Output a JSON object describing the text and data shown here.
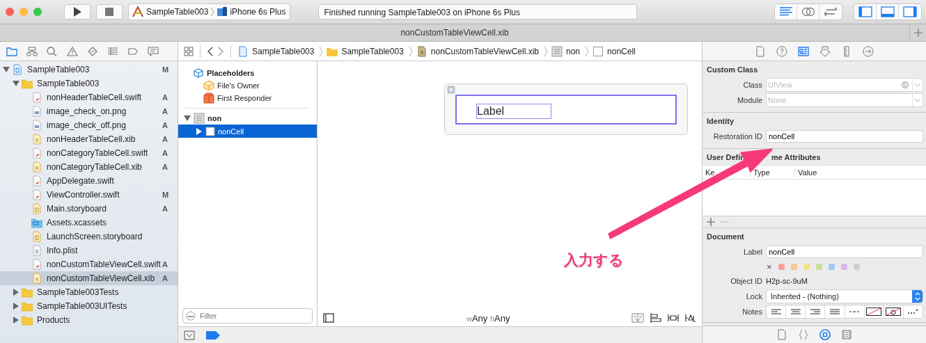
{
  "toolbar": {
    "scheme": {
      "target": "SampleTable003",
      "device": "iPhone 6s Plus"
    },
    "activity": "Finished running SampleTable003 on iPhone 6s Plus",
    "editor_modes": [
      {
        "kind": "standard",
        "selected": true
      },
      {
        "kind": "assistant",
        "selected": false
      },
      {
        "kind": "version",
        "selected": false
      }
    ],
    "panels": [
      {
        "kind": "navigator",
        "on": true
      },
      {
        "kind": "debug",
        "on": true
      },
      {
        "kind": "utilities",
        "on": true
      }
    ]
  },
  "tab": {
    "title": "nonCustomTableViewCell.xib"
  },
  "navigator": {
    "tabs": [
      {
        "kind": "folder",
        "selected": true
      },
      {
        "kind": "hierarchy",
        "selected": false
      },
      {
        "kind": "search",
        "selected": false
      },
      {
        "kind": "warning",
        "selected": false
      },
      {
        "kind": "test",
        "selected": false
      },
      {
        "kind": "debug",
        "selected": false
      },
      {
        "kind": "breakpoint",
        "selected": false
      },
      {
        "kind": "report",
        "selected": false
      }
    ],
    "tree": [
      {
        "kind": "project",
        "name": "SampleTable003",
        "status": "M",
        "expanded": true,
        "selected": false,
        "children": [
          {
            "kind": "folder",
            "name": "SampleTable003",
            "expanded": true,
            "selected": false,
            "children": [
              {
                "kind": "swift",
                "name": "nonHeaderTableCell.swift",
                "status": "A",
                "selected": false
              },
              {
                "kind": "png",
                "name": "image_check_on.png",
                "status": "A",
                "selected": false
              },
              {
                "kind": "png",
                "name": "image_check_off.png",
                "status": "A",
                "selected": false
              },
              {
                "kind": "xib",
                "name": "nonHeaderTableCell.xib",
                "status": "A",
                "selected": false
              },
              {
                "kind": "swift",
                "name": "nonCategoryTableCell.swift",
                "status": "A",
                "selected": false
              },
              {
                "kind": "xib",
                "name": "nonCategoryTableCell.xib",
                "status": "A",
                "selected": false
              },
              {
                "kind": "swift",
                "name": "AppDelegate.swift",
                "selected": false
              },
              {
                "kind": "swift",
                "name": "ViewController.swift",
                "status": "M",
                "selected": false
              },
              {
                "kind": "storyboard",
                "name": "Main.storyboard",
                "status": "A",
                "selected": false
              },
              {
                "kind": "xcassets",
                "name": "Assets.xcassets",
                "selected": false
              },
              {
                "kind": "storyboard",
                "name": "LaunchScreen.storyboard",
                "selected": false
              },
              {
                "kind": "plist",
                "name": "Info.plist",
                "selected": false
              },
              {
                "kind": "swift",
                "name": "nonCustomTableViewCell.swift",
                "status": "A",
                "selected": false
              },
              {
                "kind": "xib",
                "name": "nonCustomTableViewCell.xib",
                "status": "A",
                "selected": true
              }
            ]
          },
          {
            "kind": "folder",
            "name": "SampleTable003Tests",
            "expanded": false,
            "selected": false
          },
          {
            "kind": "folder",
            "name": "SampleTable003UITests",
            "expanded": false,
            "selected": false
          },
          {
            "kind": "folder",
            "name": "Products",
            "expanded": false,
            "selected": false
          }
        ]
      }
    ]
  },
  "jump_bar": [
    {
      "kind": "project",
      "label": "SampleTable003"
    },
    {
      "kind": "folder",
      "label": "SampleTable003"
    },
    {
      "kind": "xib",
      "label": "nonCustomTableViewCell.xib"
    },
    {
      "kind": "view",
      "label": "non"
    },
    {
      "kind": "cell",
      "label": "nonCell"
    }
  ],
  "outline": {
    "header": "Placeholders",
    "placeholders": [
      {
        "kind": "owner",
        "label": "File's Owner"
      },
      {
        "kind": "responder",
        "label": "First Responder"
      }
    ],
    "objects": [
      {
        "label": "non",
        "expanded": true,
        "selected": false,
        "children": [
          {
            "label": "nonCell",
            "expanded": false,
            "selected": true
          }
        ]
      }
    ],
    "filter": {
      "placeholder": "Filter"
    }
  },
  "canvas": {
    "label": "Label",
    "size_class": {
      "w_prefix": "w",
      "w": "Any",
      "h_prefix": "h",
      "h": "Any"
    }
  },
  "inspector": {
    "tabs": [
      {
        "kind": "file",
        "selected": false
      },
      {
        "kind": "help",
        "selected": false
      },
      {
        "kind": "identity",
        "selected": true
      },
      {
        "kind": "attributes",
        "selected": false
      },
      {
        "kind": "size",
        "selected": false
      },
      {
        "kind": "connections",
        "selected": false
      }
    ],
    "custom_class": {
      "title": "Custom Class",
      "class_label": "Class",
      "class_placeholder": "UIView",
      "module_label": "Module",
      "module_placeholder": "None"
    },
    "identity": {
      "title": "Identity",
      "restoration_label": "Restoration ID",
      "restoration_value": "nonCell"
    },
    "runtime_attributes": {
      "title_start": "User Defin",
      "title_end": "me Attributes",
      "columns": [
        "Ke",
        "Type",
        "Value"
      ]
    },
    "document": {
      "title": "Document",
      "label_label": "Label",
      "label_value": "nonCell",
      "clear_mark": "×",
      "colors": [
        {
          "color": "#f3a09d"
        },
        {
          "color": "#f5c98e"
        },
        {
          "color": "#f3e487"
        },
        {
          "color": "#c8e296"
        },
        {
          "color": "#9fcbf4"
        },
        {
          "color": "#d9b6ec"
        },
        {
          "color": "#cfcfcf"
        }
      ],
      "object_id_label": "Object ID",
      "object_id": "H2p-sc-9uM",
      "lock_label": "Lock",
      "lock_value": "Inherited - (Nothing)",
      "notes_label": "Notes"
    },
    "library_tabs": [
      {
        "kind": "file",
        "selected": false
      },
      {
        "kind": "code",
        "selected": false
      },
      {
        "kind": "object",
        "selected": true
      },
      {
        "kind": "media",
        "selected": false
      }
    ]
  },
  "annotation": {
    "text": "入力する"
  }
}
